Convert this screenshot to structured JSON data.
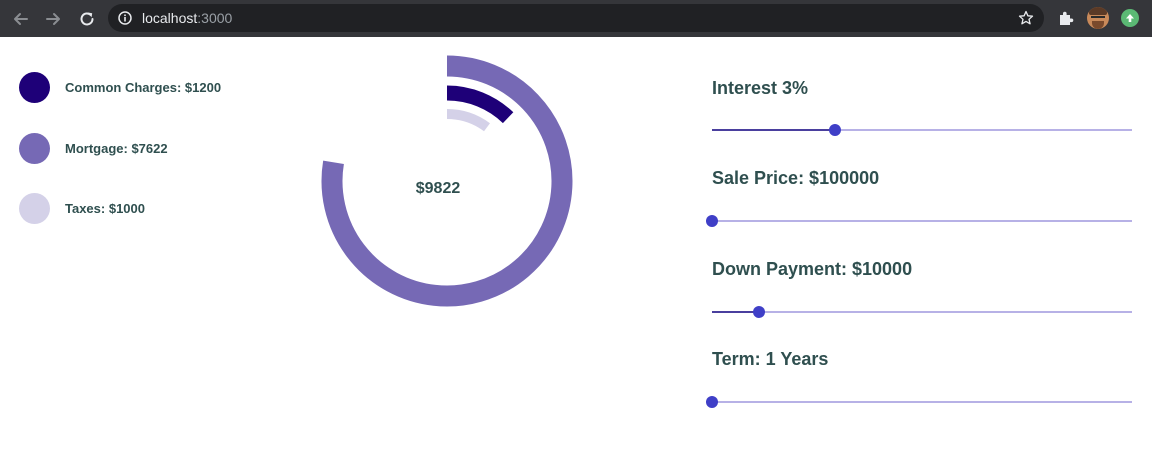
{
  "browser": {
    "url_host": "localhost",
    "url_port": ":3000"
  },
  "legend": [
    {
      "label": "Common Charges: $1200",
      "color": "#1e0078"
    },
    {
      "label": "Mortgage: $7622",
      "color": "#7669b5"
    },
    {
      "label": "Taxes: $1000",
      "color": "#d4d1e8"
    }
  ],
  "donut": {
    "total_label": "$9822",
    "segments": [
      {
        "name": "Mortgage",
        "value": 7622,
        "color": "#7669b5"
      },
      {
        "name": "Common Charges",
        "value": 1200,
        "color": "#1e0078"
      },
      {
        "name": "Taxes",
        "value": 1000,
        "color": "#d4d1e8"
      }
    ]
  },
  "sliders": [
    {
      "label": "Interest 3%",
      "fraction": 0.293
    },
    {
      "label": "Sale Price: $100000",
      "fraction": 0.0
    },
    {
      "label": "Down Payment: $10000",
      "fraction": 0.112
    },
    {
      "label": "Term: 1 Years",
      "fraction": 0.0
    }
  ]
}
